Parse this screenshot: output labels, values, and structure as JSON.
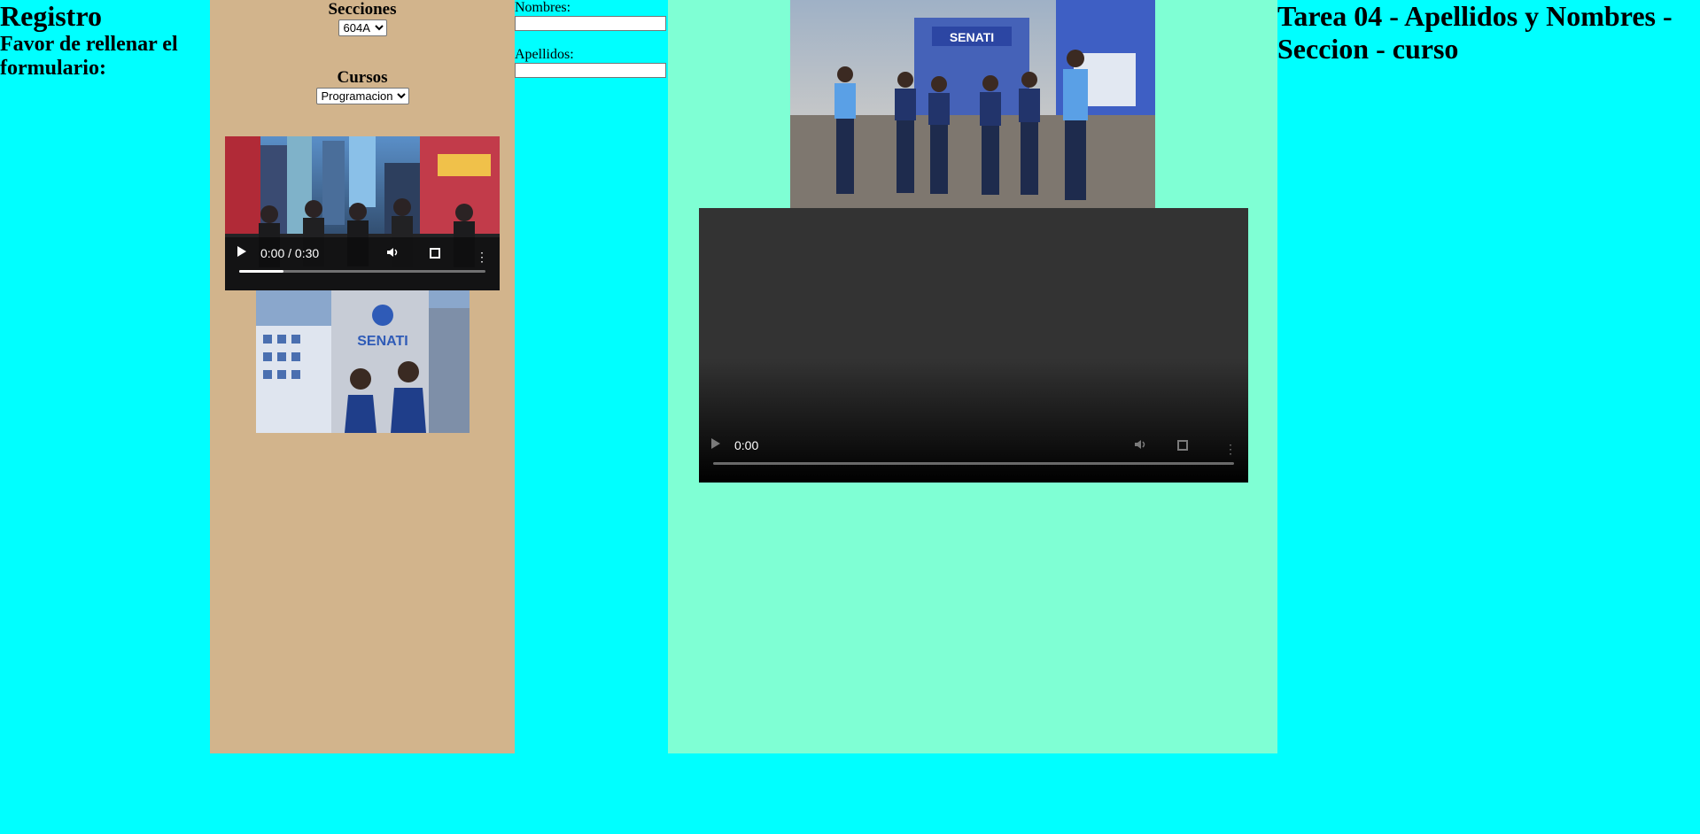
{
  "col1": {
    "title": "Registro",
    "subtitle": "Favor de rellenar el formulario:"
  },
  "col2": {
    "secciones_label": "Secciones",
    "secciones_value": "604A",
    "cursos_label": "Cursos",
    "cursos_value": "Programacion",
    "video1": {
      "time": "0:00 / 0:30",
      "buffered_fraction": 0.18
    },
    "image2_text": "SENATI"
  },
  "col3": {
    "nombres_label": "Nombres:",
    "nombres_value": "",
    "apellidos_label": "Apellidos:",
    "apellidos_value": ""
  },
  "col4": {
    "image1_text": "SENATI",
    "video2": {
      "time": "0:00",
      "buffered_fraction": 0
    }
  },
  "col5": {
    "title": "Tarea 04 - Apellidos y Nombres - Seccion - curso"
  },
  "colors": {
    "page_bg": "#00ffff",
    "col2_bg": "#d2b48c",
    "col4_bg": "#7fffd4"
  }
}
